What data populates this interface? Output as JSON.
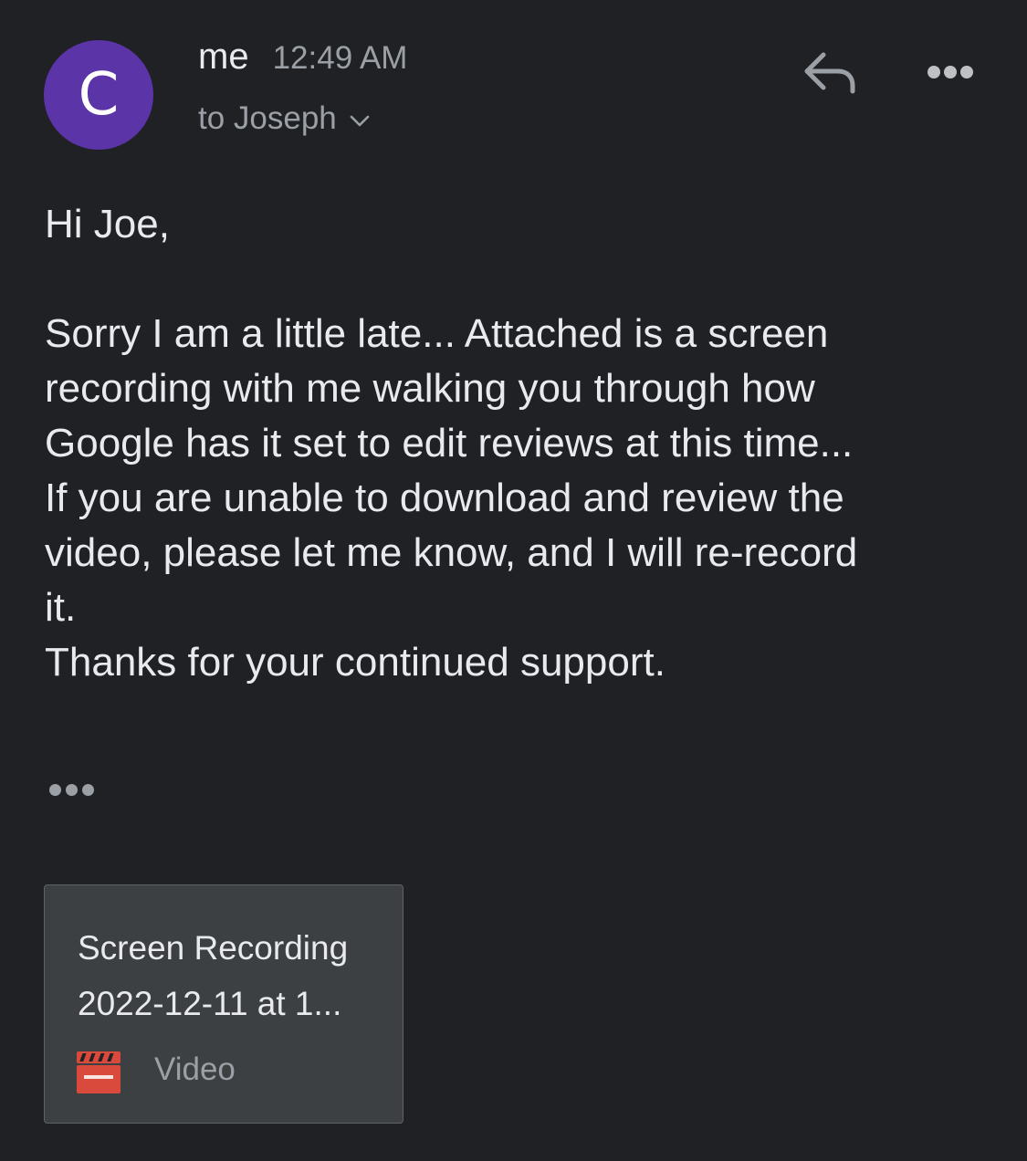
{
  "header": {
    "avatar_initial": "C",
    "avatar_color": "#5b34a8",
    "sender": "me",
    "time": "12:49 AM",
    "recipient": "to Joseph",
    "recipient_toggle_icon": "chevron-down-icon",
    "reply_icon": "reply-icon",
    "more_icon": "more-horizontal-icon"
  },
  "message": {
    "greeting": "Hi Joe,",
    "lines": [
      "Sorry I am a little late... Attached is a screen",
      "recording with me walking you through how",
      "Google has it set to edit reviews at this time...",
      "If you are unable to download and review the",
      "video, please let me know, and I will re-record",
      "it.",
      "Thanks for your continued support."
    ],
    "show_trimmed_icon": "more-horizontal-icon"
  },
  "attachment": {
    "name_line1": "Screen Recording",
    "name_line2": "2022-12-11 at 1...",
    "type": "Video",
    "icon": "video-clapperboard-icon",
    "icon_color": "#d9493c"
  },
  "colors": {
    "background": "#202124",
    "card": "#3c4043",
    "text_primary": "#e8eaed",
    "text_secondary": "#9aa0a6"
  }
}
